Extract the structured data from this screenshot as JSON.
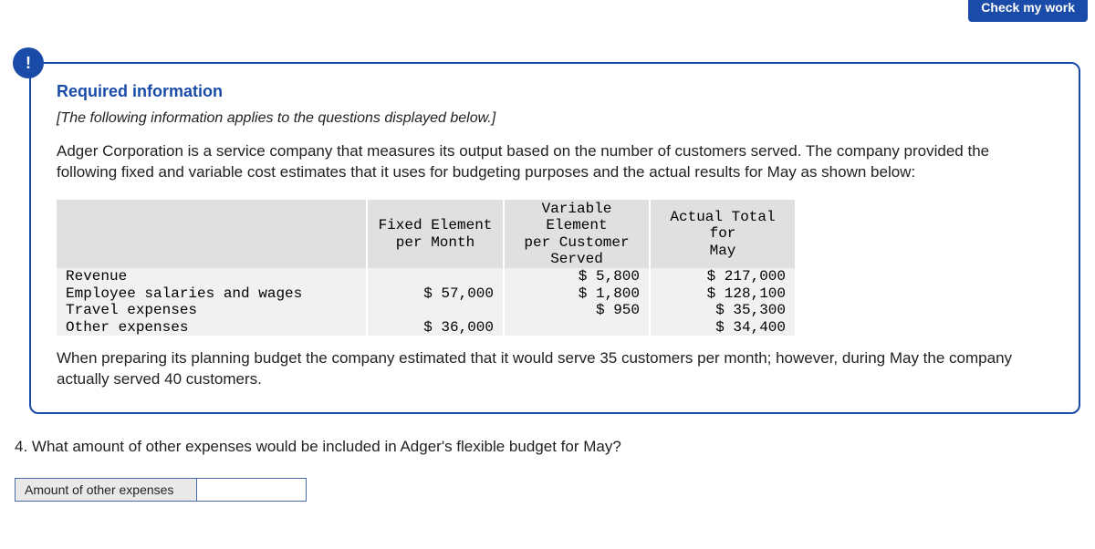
{
  "button": {
    "check": "Check my work"
  },
  "alert_icon": "!",
  "info": {
    "required_title": "Required information",
    "italic_note": "[The following information applies to the questions displayed below.]",
    "intro": "Adger Corporation is a service company that measures its output based on the number of customers served. The company provided the following fixed and variable cost estimates that it uses for budgeting purposes and the actual results for May as shown below:",
    "closing": "When preparing its planning budget the company estimated that it would serve 35 customers per month; however, during May the company actually served 40 customers."
  },
  "table": {
    "headers": {
      "fixed": "Fixed Element\nper Month",
      "variable": "Variable Element\nper Customer\nServed",
      "actual": "Actual Total for\nMay"
    },
    "rows": [
      {
        "label": "Revenue",
        "fixed": "",
        "variable": "$ 5,800",
        "actual": "$ 217,000"
      },
      {
        "label": "Employee salaries and wages",
        "fixed": "$ 57,000",
        "variable": "$ 1,800",
        "actual": "$ 128,100"
      },
      {
        "label": "Travel expenses",
        "fixed": "",
        "variable": "$ 950",
        "actual": "$ 35,300"
      },
      {
        "label": "Other expenses",
        "fixed": "$ 36,000",
        "variable": "",
        "actual": "$ 34,400"
      }
    ]
  },
  "question": {
    "number": "4.",
    "text": "What amount of other expenses would be included in Adger's flexible budget for May?",
    "answer_label": "Amount of other expenses",
    "answer_value": ""
  },
  "chart_data": {
    "type": "table",
    "columns": [
      "Item",
      "Fixed Element per Month",
      "Variable Element per Customer Served",
      "Actual Total for May"
    ],
    "rows": [
      [
        "Revenue",
        null,
        5800,
        217000
      ],
      [
        "Employee salaries and wages",
        57000,
        1800,
        128100
      ],
      [
        "Travel expenses",
        null,
        950,
        35300
      ],
      [
        "Other expenses",
        36000,
        null,
        34400
      ]
    ],
    "planned_customers": 35,
    "actual_customers": 40
  }
}
